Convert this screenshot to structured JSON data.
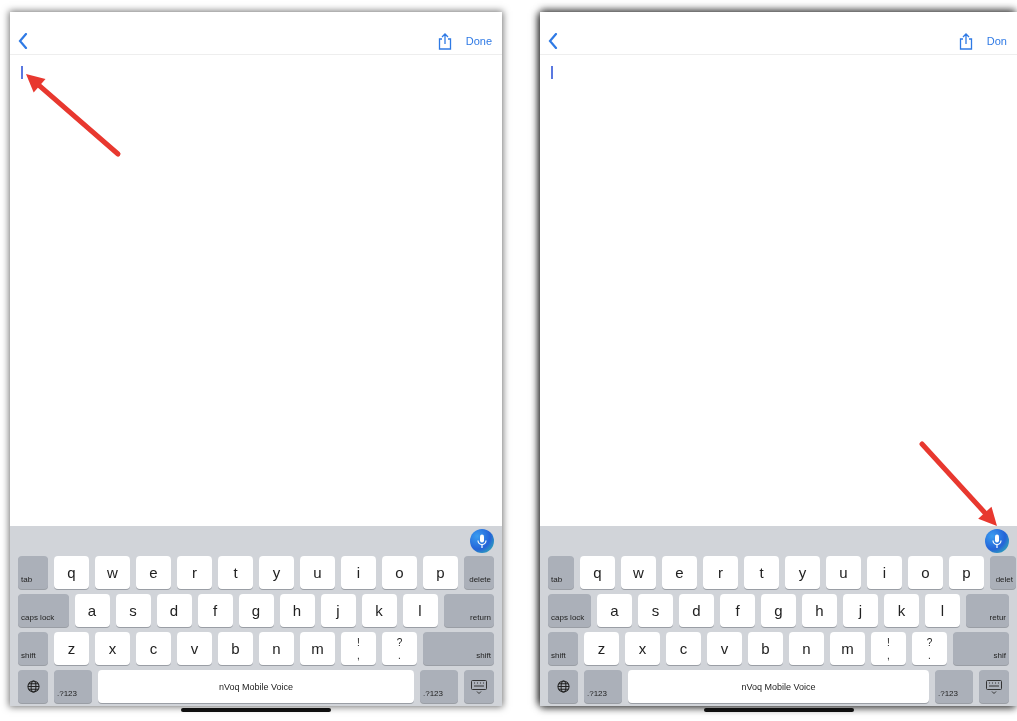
{
  "screens": [
    {
      "nav": {
        "done": "Done"
      },
      "cursor": true,
      "annotation": {
        "kind": "cursor-arrow"
      },
      "keyboard": {
        "key_rows": [
          [
            {
              "kind": "mod",
              "label": "tab"
            },
            {
              "kind": "letter",
              "label": "q"
            },
            {
              "kind": "letter",
              "label": "w"
            },
            {
              "kind": "letter",
              "label": "e"
            },
            {
              "kind": "letter",
              "label": "r"
            },
            {
              "kind": "letter",
              "label": "t"
            },
            {
              "kind": "letter",
              "label": "y"
            },
            {
              "kind": "letter",
              "label": "u"
            },
            {
              "kind": "letter",
              "label": "i"
            },
            {
              "kind": "letter",
              "label": "o"
            },
            {
              "kind": "letter",
              "label": "p"
            },
            {
              "kind": "mod",
              "label": "delete"
            }
          ],
          [
            {
              "kind": "mod",
              "label": "caps lock"
            },
            {
              "kind": "letter",
              "label": "a"
            },
            {
              "kind": "letter",
              "label": "s"
            },
            {
              "kind": "letter",
              "label": "d"
            },
            {
              "kind": "letter",
              "label": "f"
            },
            {
              "kind": "letter",
              "label": "g"
            },
            {
              "kind": "letter",
              "label": "h"
            },
            {
              "kind": "letter",
              "label": "j"
            },
            {
              "kind": "letter",
              "label": "k"
            },
            {
              "kind": "letter",
              "label": "l"
            },
            {
              "kind": "mod",
              "label": "return"
            }
          ],
          [
            {
              "kind": "mod",
              "label": "shift"
            },
            {
              "kind": "letter",
              "label": "z"
            },
            {
              "kind": "letter",
              "label": "x"
            },
            {
              "kind": "letter",
              "label": "c"
            },
            {
              "kind": "letter",
              "label": "v"
            },
            {
              "kind": "letter",
              "label": "b"
            },
            {
              "kind": "letter",
              "label": "n"
            },
            {
              "kind": "letter",
              "label": "m"
            },
            {
              "kind": "punct",
              "label": "!",
              "sub": ","
            },
            {
              "kind": "punct",
              "label": "?",
              "sub": "."
            },
            {
              "kind": "mod",
              "label": "shift"
            }
          ],
          [
            {
              "kind": "globe"
            },
            {
              "kind": "mod",
              "label": ".?123"
            },
            {
              "kind": "space",
              "label": "nVoq Mobile Voice"
            },
            {
              "kind": "mod",
              "label": ".?123"
            },
            {
              "kind": "hide-keyboard"
            }
          ]
        ]
      }
    },
    {
      "nav": {
        "done": "Don"
      },
      "cursor": true,
      "annotation": {
        "kind": "mic-arrow"
      },
      "keyboard": {
        "key_rows": [
          [
            {
              "kind": "mod",
              "label": "tab"
            },
            {
              "kind": "letter",
              "label": "q"
            },
            {
              "kind": "letter",
              "label": "w"
            },
            {
              "kind": "letter",
              "label": "e"
            },
            {
              "kind": "letter",
              "label": "r"
            },
            {
              "kind": "letter",
              "label": "t"
            },
            {
              "kind": "letter",
              "label": "y"
            },
            {
              "kind": "letter",
              "label": "u"
            },
            {
              "kind": "letter",
              "label": "i"
            },
            {
              "kind": "letter",
              "label": "o"
            },
            {
              "kind": "letter",
              "label": "p"
            },
            {
              "kind": "mod",
              "label": "delet"
            }
          ],
          [
            {
              "kind": "mod",
              "label": "caps lock"
            },
            {
              "kind": "letter",
              "label": "a"
            },
            {
              "kind": "letter",
              "label": "s"
            },
            {
              "kind": "letter",
              "label": "d"
            },
            {
              "kind": "letter",
              "label": "f"
            },
            {
              "kind": "letter",
              "label": "g"
            },
            {
              "kind": "letter",
              "label": "h"
            },
            {
              "kind": "letter",
              "label": "j"
            },
            {
              "kind": "letter",
              "label": "k"
            },
            {
              "kind": "letter",
              "label": "l"
            },
            {
              "kind": "mod",
              "label": "retur"
            }
          ],
          [
            {
              "kind": "mod",
              "label": "shift"
            },
            {
              "kind": "letter",
              "label": "z"
            },
            {
              "kind": "letter",
              "label": "x"
            },
            {
              "kind": "letter",
              "label": "c"
            },
            {
              "kind": "letter",
              "label": "v"
            },
            {
              "kind": "letter",
              "label": "b"
            },
            {
              "kind": "letter",
              "label": "n"
            },
            {
              "kind": "letter",
              "label": "m"
            },
            {
              "kind": "punct",
              "label": "!",
              "sub": ","
            },
            {
              "kind": "punct",
              "label": "?",
              "sub": "."
            },
            {
              "kind": "mod",
              "label": "shif"
            }
          ],
          [
            {
              "kind": "globe"
            },
            {
              "kind": "mod",
              "label": ".?123"
            },
            {
              "kind": "space",
              "label": "nVoq Mobile Voice"
            },
            {
              "kind": "mod",
              "label": ".?123"
            },
            {
              "kind": "hide-keyboard"
            }
          ]
        ]
      }
    }
  ]
}
